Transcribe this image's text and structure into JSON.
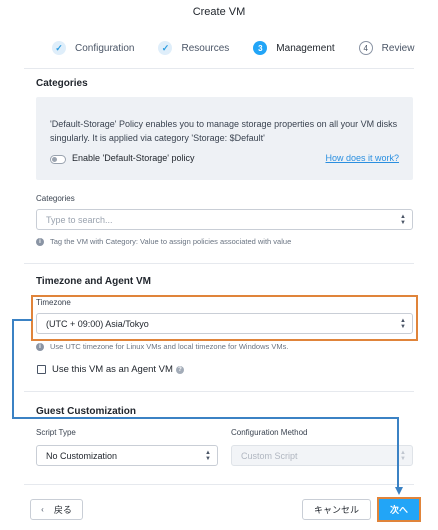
{
  "dialog": {
    "title": "Create VM"
  },
  "stepper": {
    "steps": [
      {
        "marker": "✓",
        "label": "Configuration",
        "state": "done"
      },
      {
        "marker": "✓",
        "label": "Resources",
        "state": "done"
      },
      {
        "marker": "3",
        "label": "Management",
        "state": "active"
      },
      {
        "marker": "4",
        "label": "Review",
        "state": "todo"
      }
    ]
  },
  "categories_section": {
    "title": "Categories",
    "info_text": "'Default-Storage' Policy enables you to manage storage properties on all your VM disks singularly. It is applied via category 'Storage: $Default'",
    "toggle_label": "Enable 'Default-Storage' policy",
    "toggle_on": false,
    "link": "How does it work?",
    "field_label": "Categories",
    "search_placeholder": "Type to search...",
    "help_text": "Tag the VM with Category: Value to assign policies associated with value"
  },
  "timezone_section": {
    "title": "Timezone and Agent VM",
    "field_label": "Timezone",
    "selected": "(UTC + 09:00) Asia/Tokyo",
    "help_text": "Use UTC timezone for Linux VMs and local timezone for Windows VMs.",
    "agent_vm_label": "Use this VM as an Agent VM",
    "agent_vm_checked": false
  },
  "guest_section": {
    "title": "Guest Customization",
    "script_type_label": "Script Type",
    "script_type_value": "No Customization",
    "config_method_label": "Configuration Method",
    "config_method_value": "Custom Script"
  },
  "footer": {
    "back_label": "戻る",
    "cancel_label": "キャンセル",
    "next_label": "次へ"
  },
  "colors": {
    "accent": "#22a5f7",
    "annotation_box": "#e0843a",
    "annotation_arrow": "#3b82c4",
    "link": "#2a8fe0"
  }
}
